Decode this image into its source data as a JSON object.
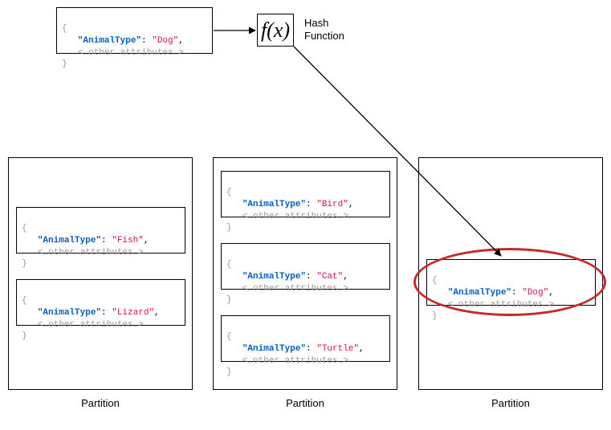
{
  "input": {
    "key": "\"AnimalType\"",
    "value": "\"Dog\"",
    "other": "<…other attributes…>"
  },
  "fx": {
    "symbol": "f(x)",
    "label": "Hash Function"
  },
  "partitions": [
    {
      "label": "Partition",
      "records": [
        {
          "key": "\"AnimalType\"",
          "value": "\"Fish\"",
          "other": "<…other attributes…>"
        },
        {
          "key": "\"AnimalType\"",
          "value": "\"Lizard\"",
          "other": "<…other attributes…>"
        }
      ]
    },
    {
      "label": "Partition",
      "records": [
        {
          "key": "\"AnimalType\"",
          "value": "\"Bird\"",
          "other": "<…other attributes…>"
        },
        {
          "key": "\"AnimalType\"",
          "value": "\"Cat\"",
          "other": "<…other attributes…>"
        },
        {
          "key": "\"AnimalType\"",
          "value": "\"Turtle\"",
          "other": "<…other attributes…>"
        }
      ]
    },
    {
      "label": "Partition",
      "records": [
        {
          "key": "\"AnimalType\"",
          "value": "\"Dog\"",
          "other": "<…other attributes…>"
        }
      ]
    }
  ],
  "braces": {
    "open": "{",
    "close": "}"
  }
}
